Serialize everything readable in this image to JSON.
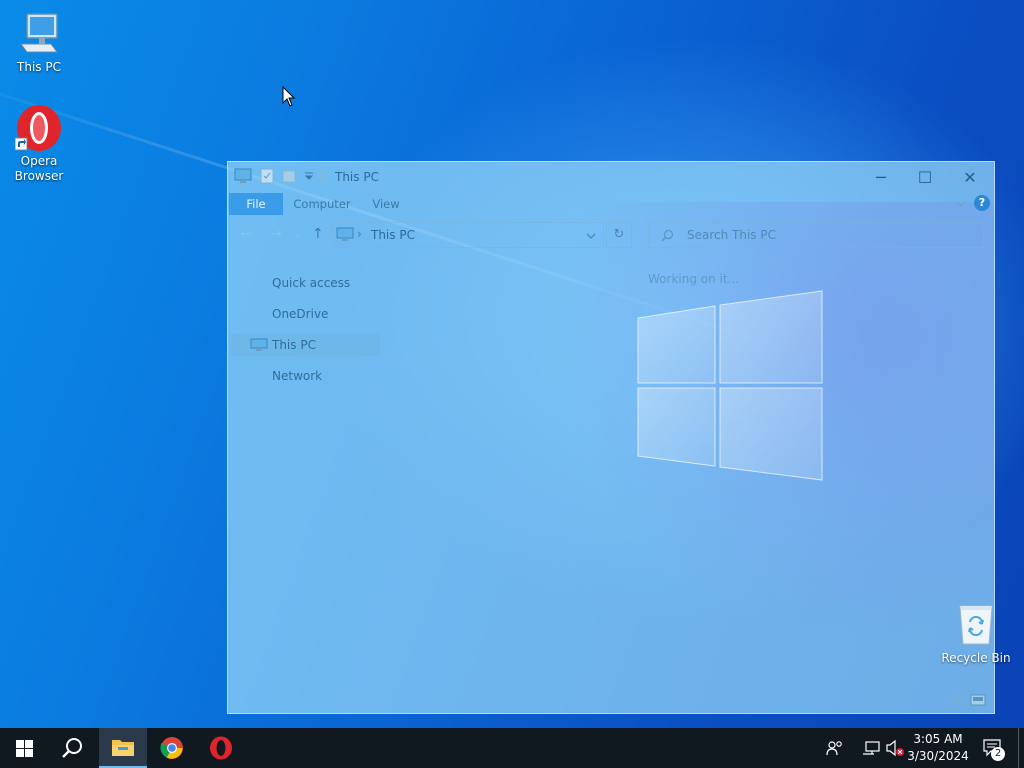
{
  "desktop": {
    "icons": [
      {
        "label": "This PC"
      },
      {
        "label": "Opera Browser"
      },
      {
        "label": "Recycle Bin"
      }
    ]
  },
  "explorer": {
    "title": "This PC",
    "ribbon_tabs": [
      "File",
      "Computer",
      "View"
    ],
    "address": {
      "path": "This PC",
      "separator": "›"
    },
    "search_placeholder": "Search This PC",
    "nav_items": [
      "Quick access",
      "OneDrive",
      "This PC",
      "Network"
    ],
    "selected_nav": "This PC",
    "status_text": "Working on it...",
    "window_controls": {
      "minimize": "─",
      "maximize": "☐",
      "close": "✕"
    },
    "help_label": "?"
  },
  "taskbar": {
    "pinned": [
      "start-button",
      "search-button",
      "file-explorer",
      "chrome",
      "opera"
    ],
    "active": "file-explorer",
    "clock": {
      "time": "3:05 AM",
      "date": "3/30/2024"
    },
    "notification_count": "2"
  },
  "colors": {
    "taskbar": "#101820",
    "accent": "#76b9ed",
    "opera_red": "#e0242c"
  }
}
